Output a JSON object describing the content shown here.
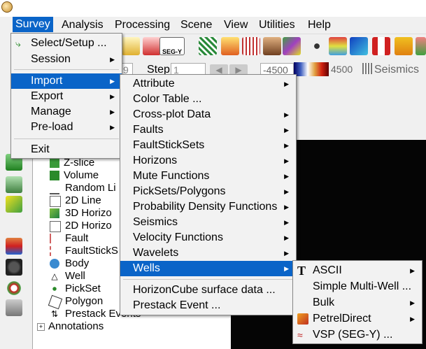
{
  "menubar": {
    "items": [
      "Survey",
      "Analysis",
      "Processing",
      "Scene",
      "View",
      "Utilities",
      "Help"
    ],
    "active": "Survey"
  },
  "toolbar": {
    "segy_label": "SEG-Y",
    "step_label": "Step",
    "step_value": "1",
    "inline_value": "9",
    "color_min": "-4500",
    "color_max": "4500",
    "seismics_label": "Seismics"
  },
  "survey_menu": {
    "items": [
      "Select/Setup ...",
      "Session",
      "Import",
      "Export",
      "Manage",
      "Pre-load",
      "Exit"
    ]
  },
  "import_menu": {
    "items": [
      "Attribute",
      "Color Table ...",
      "Cross-plot Data",
      "Faults",
      "FaultStickSets",
      "Horizons",
      "Mute Functions",
      "PickSets/Polygons",
      "Probability Density Functions",
      "Seismics",
      "Velocity Functions",
      "Wavelets",
      "Wells",
      "HorizonCube surface data ...",
      "Prestack Event ..."
    ]
  },
  "wells_menu": {
    "items": [
      "ASCII",
      "Simple Multi-Well ...",
      "Bulk",
      "PetrelDirect",
      "VSP (SEG-Y) ..."
    ]
  },
  "tree": {
    "items": [
      "Z-slice",
      "Volume",
      "Random Li",
      "2D Line",
      "3D Horizo",
      "2D Horizo",
      "Fault",
      "FaultStickS",
      "Body",
      "Well",
      "PickSet",
      "Polygon",
      "Prestack Events",
      "Annotations"
    ]
  },
  "colors": {
    "accent": "#0a64c8",
    "menu_bg": "#f2f2f2"
  }
}
